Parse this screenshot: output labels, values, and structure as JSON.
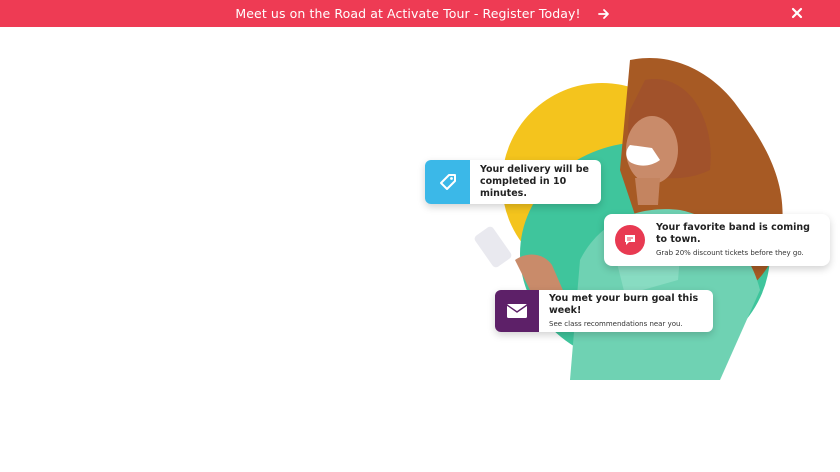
{
  "banner": {
    "text": "Meet us on the Road at Activate Tour - Register Today!",
    "arrow_icon": "arrow-right-icon",
    "close_icon": "close-icon",
    "background": "#ee3b54"
  },
  "notifications": [
    {
      "icon": "tag-icon",
      "title": "Your delivery will be completed in 10 minutes.",
      "subtitle": "",
      "color": "#3bb8e8"
    },
    {
      "icon": "chat-icon",
      "title": "Your favorite band is coming to town.",
      "subtitle": "Grab 20% discount tickets before they go.",
      "color": "#e83a52"
    },
    {
      "icon": "mail-icon",
      "title": "You met your burn goal this week!",
      "subtitle": "See class recommendations near you.",
      "color": "#5d2068"
    }
  ],
  "colors": {
    "yellow_circle": "#f4c41d",
    "green_circle": "#3fc59c"
  }
}
